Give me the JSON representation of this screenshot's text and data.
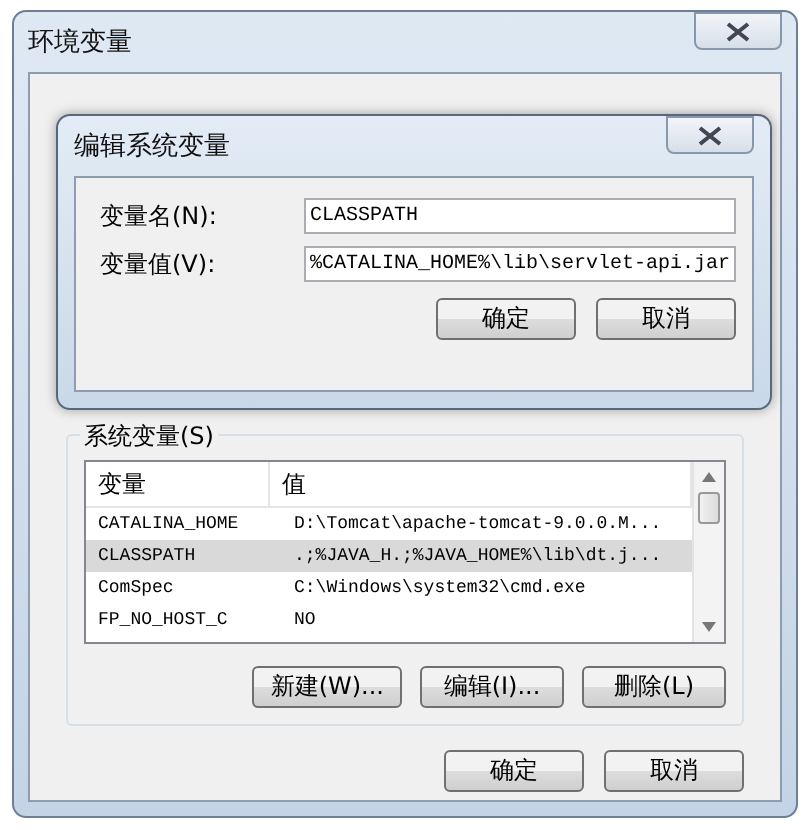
{
  "window": {
    "title": "环境变量"
  },
  "edit_dialog": {
    "title": "编辑系统变量",
    "fields": [
      {
        "label": "变量名(N):",
        "value": "CLASSPATH"
      },
      {
        "label": "变量值(V):",
        "value": "%CATALINA_HOME%\\lib\\servlet-api.jar"
      }
    ],
    "buttons": [
      "确定",
      "取消"
    ]
  },
  "system_vars": {
    "label": "系统变量(S)",
    "columns": [
      "变量",
      "值"
    ],
    "rows": [
      {
        "name": "CATALINA_HOME",
        "value": "D:\\Tomcat\\apache-tomcat-9.0.0.M...",
        "selected": false
      },
      {
        "name": "CLASSPATH",
        "value": ".;%JAVA_H.;%JAVA_HOME%\\lib\\dt.j...",
        "selected": true
      },
      {
        "name": "ComSpec",
        "value": "C:\\Windows\\system32\\cmd.exe",
        "selected": false
      },
      {
        "name": "FP_NO_HOST_C",
        "value": "NO",
        "selected": false
      }
    ],
    "buttons": [
      "新建(W)...",
      "编辑(I)...",
      "删除(L)"
    ]
  },
  "buttons": [
    "确定",
    "取消"
  ]
}
